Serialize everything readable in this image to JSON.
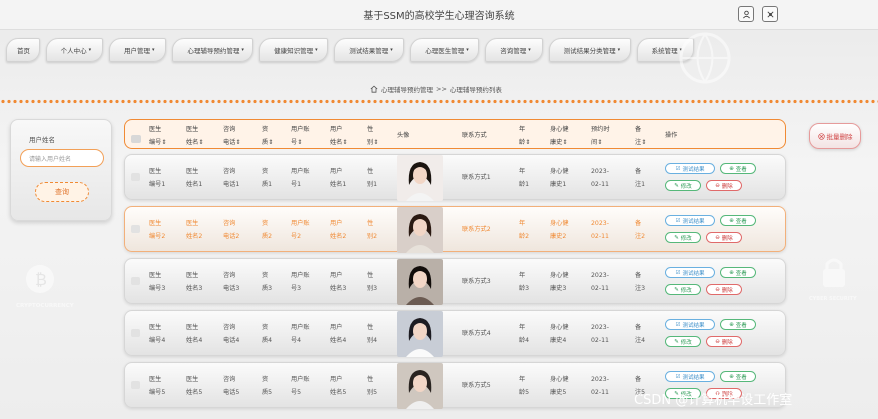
{
  "app": {
    "title": "基于SSM的高校学生心理咨询系统"
  },
  "nav": {
    "items": [
      {
        "label": "首页",
        "caret": false
      },
      {
        "label": "个人中心",
        "caret": true
      },
      {
        "label": "用户管理",
        "caret": true
      },
      {
        "label": "心理辅导预约管理",
        "caret": true
      },
      {
        "label": "健康知识管理",
        "caret": true
      },
      {
        "label": "测试结果管理",
        "caret": true
      },
      {
        "label": "心理医生管理",
        "caret": true
      },
      {
        "label": "咨询管理",
        "caret": true
      },
      {
        "label": "测试结果分类管理",
        "caret": true
      },
      {
        "label": "系统管理",
        "caret": true
      }
    ]
  },
  "breadcrumb": {
    "section": "心理辅导预约管理",
    "separator": ">>",
    "current": "心理辅导预约列表"
  },
  "search": {
    "label": "用户姓名",
    "placeholder": "请输入用户姓名",
    "button": "查询"
  },
  "toolbar": {
    "bulk_delete": "批量删除"
  },
  "table": {
    "columns": [
      {
        "l1": "医生",
        "l2": "编号"
      },
      {
        "l1": "医生",
        "l2": "姓名"
      },
      {
        "l1": "咨询",
        "l2": "电话"
      },
      {
        "l1": "资",
        "l2": "质"
      },
      {
        "l1": "用户账",
        "l2": "号"
      },
      {
        "l1": "用户",
        "l2": "姓名"
      },
      {
        "l1": "性",
        "l2": "别"
      },
      {
        "l1": "头像",
        "l2": ""
      },
      {
        "l1": "联系方式",
        "l2": ""
      },
      {
        "l1": "年",
        "l2": "龄"
      },
      {
        "l1": "身心健",
        "l2": "康史"
      },
      {
        "l1": "预约时",
        "l2": "间"
      },
      {
        "l1": "备",
        "l2": "注"
      },
      {
        "l1": "操作",
        "l2": ""
      }
    ],
    "sort_icon": "⇕",
    "actions": {
      "test_result": "测试结果",
      "view": "查看",
      "edit": "修改",
      "delete": "删除"
    },
    "rows": [
      {
        "c": [
          [
            "医生",
            "编号1"
          ],
          [
            "医生",
            "姓名1"
          ],
          [
            "咨询",
            "电话1"
          ],
          [
            "资",
            "质1"
          ],
          [
            "用户账",
            "号1"
          ],
          [
            "用户",
            "姓名1"
          ],
          [
            "性",
            "别1"
          ],
          [
            "联系方式1",
            ""
          ],
          [
            "年",
            "龄1"
          ],
          [
            "身心健",
            "康史1"
          ],
          [
            "2023-",
            "02-11"
          ],
          [
            "备",
            "注1"
          ]
        ]
      },
      {
        "c": [
          [
            "医生",
            "编号2"
          ],
          [
            "医生",
            "姓名2"
          ],
          [
            "咨询",
            "电话2"
          ],
          [
            "资",
            "质2"
          ],
          [
            "用户账",
            "号2"
          ],
          [
            "用户",
            "姓名2"
          ],
          [
            "性",
            "别2"
          ],
          [
            "联系方式2",
            ""
          ],
          [
            "年",
            "龄2"
          ],
          [
            "身心健",
            "康史2"
          ],
          [
            "2023-",
            "02-11"
          ],
          [
            "备",
            "注2"
          ]
        ]
      },
      {
        "c": [
          [
            "医生",
            "编号3"
          ],
          [
            "医生",
            "姓名3"
          ],
          [
            "咨询",
            "电话3"
          ],
          [
            "资",
            "质3"
          ],
          [
            "用户账",
            "号3"
          ],
          [
            "用户",
            "姓名3"
          ],
          [
            "性",
            "别3"
          ],
          [
            "联系方式3",
            ""
          ],
          [
            "年",
            "龄3"
          ],
          [
            "身心健",
            "康史3"
          ],
          [
            "2023-",
            "02-11"
          ],
          [
            "备",
            "注3"
          ]
        ]
      },
      {
        "c": [
          [
            "医生",
            "编号4"
          ],
          [
            "医生",
            "姓名4"
          ],
          [
            "咨询",
            "电话4"
          ],
          [
            "资",
            "质4"
          ],
          [
            "用户账",
            "号4"
          ],
          [
            "用户",
            "姓名4"
          ],
          [
            "性",
            "别4"
          ],
          [
            "联系方式4",
            ""
          ],
          [
            "年",
            "龄4"
          ],
          [
            "身心健",
            "康史4"
          ],
          [
            "2023-",
            "02-11"
          ],
          [
            "备",
            "注4"
          ]
        ]
      },
      {
        "c": [
          [
            "医生",
            "编号5"
          ],
          [
            "医生",
            "姓名5"
          ],
          [
            "咨询",
            "电话5"
          ],
          [
            "资",
            "质5"
          ],
          [
            "用户账",
            "号5"
          ],
          [
            "用户",
            "姓名5"
          ],
          [
            "性",
            "别5"
          ],
          [
            "联系方式5",
            ""
          ],
          [
            "年",
            "龄5"
          ],
          [
            "身心健",
            "康史5"
          ],
          [
            "2023-",
            "02-11"
          ],
          [
            "备",
            "注5"
          ]
        ]
      }
    ]
  },
  "decorations": {
    "left_caption": "CRYPTOCURRENCY",
    "right_caption": "CYBER SECURITY"
  },
  "watermark": "CSDN @计算机毕设工作室",
  "colors": {
    "accent": "#f08a34",
    "danger": "#d04444",
    "info": "#3d8fc9",
    "success": "#2f9c58"
  }
}
